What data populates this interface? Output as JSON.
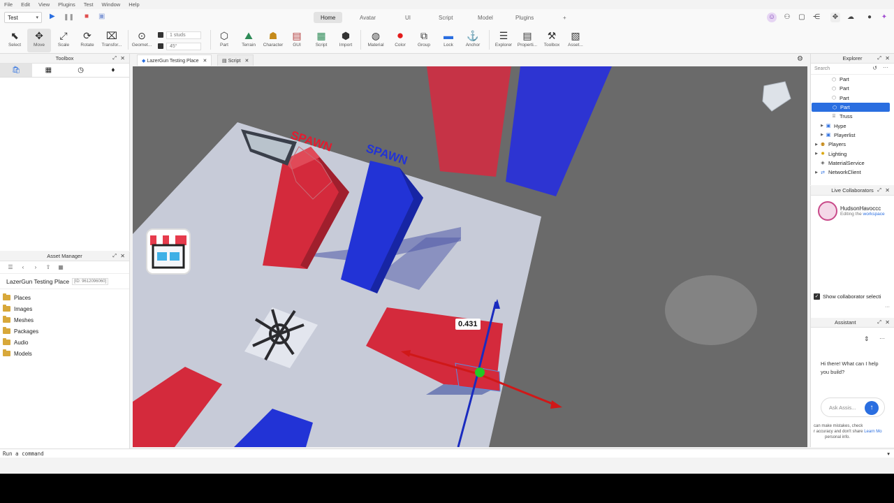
{
  "menu": [
    "File",
    "Edit",
    "View",
    "Plugins",
    "Test",
    "Window",
    "Help"
  ],
  "test_mode": "Test",
  "ribbon_tabs": [
    "Home",
    "Avatar",
    "UI",
    "Script",
    "Model",
    "Plugins",
    "+"
  ],
  "active_ribbon_tab": "Home",
  "tools": [
    {
      "label": "Select",
      "icon": "cursor-icon"
    },
    {
      "label": "Move",
      "icon": "move-icon"
    },
    {
      "label": "Scale",
      "icon": "scale-icon"
    },
    {
      "label": "Rotate",
      "icon": "rotate-icon"
    },
    {
      "label": "Transfor...",
      "icon": "transform-icon"
    },
    {
      "label": "Geomet...",
      "icon": "geometry-icon"
    },
    {
      "label": "Part",
      "icon": "part-icon"
    },
    {
      "label": "Terrain",
      "icon": "terrain-icon"
    },
    {
      "label": "Character",
      "icon": "character-icon"
    },
    {
      "label": "GUI",
      "icon": "gui-icon"
    },
    {
      "label": "Script",
      "icon": "script-icon"
    },
    {
      "label": "Import",
      "icon": "import-icon"
    },
    {
      "label": "Material",
      "icon": "material-icon"
    },
    {
      "label": "Color",
      "icon": "color-icon"
    },
    {
      "label": "Group",
      "icon": "group-icon"
    },
    {
      "label": "Lock",
      "icon": "lock-icon"
    },
    {
      "label": "Anchor",
      "icon": "anchor-icon"
    },
    {
      "label": "Explorer",
      "icon": "explorer-icon"
    },
    {
      "label": "Properti...",
      "icon": "properties-icon"
    },
    {
      "label": "Toolbox",
      "icon": "toolbox-icon"
    },
    {
      "label": "Asset...",
      "icon": "asset-icon"
    }
  ],
  "snap": {
    "move": "1 studs",
    "rotate": "45°"
  },
  "toolbox": {
    "title": "Toolbox"
  },
  "asset_manager": {
    "title": "Asset Manager",
    "place_name": "LazerGun Testing Place",
    "place_id": "[ID: 9612096060]",
    "folders": [
      "Places",
      "Images",
      "Meshes",
      "Packages",
      "Audio",
      "Models"
    ]
  },
  "doc_tabs": [
    {
      "label": "LazerGun Testing Place"
    },
    {
      "label": "Script"
    }
  ],
  "viewport": {
    "measurement": "0.431",
    "spawn_red": "SPAWN",
    "spawn_blue": "SPAWN",
    "colors": {
      "red_part": "#d42a3c",
      "blue_part": "#2233d6",
      "floor": "#c7cbd8",
      "void": "#6a6a6a"
    }
  },
  "explorer": {
    "title": "Explorer",
    "search_placeholder": "Search",
    "items": [
      {
        "label": "Part",
        "icon": "part-icon",
        "indent": 2,
        "arrow": false,
        "selected": false
      },
      {
        "label": "Part",
        "icon": "part-icon",
        "indent": 2,
        "arrow": false,
        "selected": false
      },
      {
        "label": "Part",
        "icon": "part-icon",
        "indent": 2,
        "arrow": false,
        "selected": false
      },
      {
        "label": "Part",
        "icon": "part-icon",
        "indent": 2,
        "arrow": false,
        "selected": true
      },
      {
        "label": "Truss",
        "icon": "truss-icon",
        "indent": 2,
        "arrow": false,
        "selected": false
      },
      {
        "label": "Hype",
        "icon": "model-icon",
        "indent": 1,
        "arrow": true,
        "selected": false
      },
      {
        "label": "Playerlist",
        "icon": "model-icon",
        "indent": 1,
        "arrow": true,
        "selected": false
      },
      {
        "label": "Players",
        "icon": "players-icon",
        "indent": 0,
        "arrow": true,
        "selected": false
      },
      {
        "label": "Lighting",
        "icon": "lighting-icon",
        "indent": 0,
        "arrow": true,
        "selected": false
      },
      {
        "label": "MaterialService",
        "icon": "material-service-icon",
        "indent": 0,
        "arrow": false,
        "selected": false
      },
      {
        "label": "NetworkClient",
        "icon": "network-icon",
        "indent": 0,
        "arrow": true,
        "selected": false
      }
    ]
  },
  "collaborators": {
    "title": "Live Collaborators",
    "user": "HudsonHavoccc",
    "status_prefix": "Editing the",
    "status_link": "workspace",
    "show_label": "Show collaborator selecti"
  },
  "assistant": {
    "title": "Assistant",
    "greeting": "Hi there! What can I help you build?",
    "input_placeholder": "Ask Assis...",
    "disclaimer_1": "can make mistakes, check",
    "disclaimer_2": "r accuracy and don't share",
    "disclaimer_link": "Learn Mo",
    "disclaimer_3": "personal info."
  },
  "command_bar": {
    "placeholder": "Run a command"
  }
}
